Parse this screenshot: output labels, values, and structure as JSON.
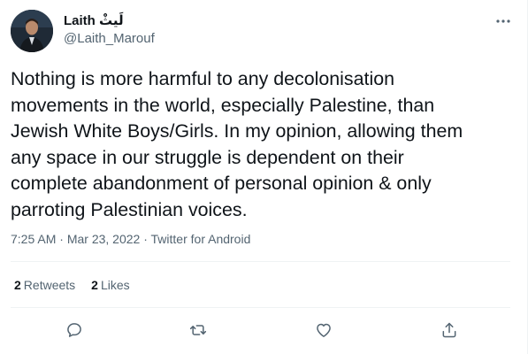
{
  "user": {
    "display_name": "Laith لَيثْ",
    "handle": "@Laith_Marouf"
  },
  "tweet": {
    "text": "Nothing is more harmful to any decolonisation\nmovements in the world, especially Palestine, than\nJewish White Boys/Girls. In my opinion, allowing them\nany space in our struggle is dependent on their\ncomplete abandonment of personal opinion & only\nparroting Palestinian voices.",
    "time": "7:25 AM",
    "date": "Mar 23, 2022",
    "source": "Twitter for Android",
    "separator": "·"
  },
  "stats": {
    "retweets_count": "2",
    "retweets_label": "Retweets",
    "likes_count": "2",
    "likes_label": "Likes"
  },
  "actions": [
    "reply-icon",
    "retweet-icon",
    "like-icon",
    "share-icon"
  ],
  "more_icon": "more-icon",
  "colors": {
    "text": "#0f1419",
    "secondary": "#536471",
    "divider": "#eff3f4"
  }
}
